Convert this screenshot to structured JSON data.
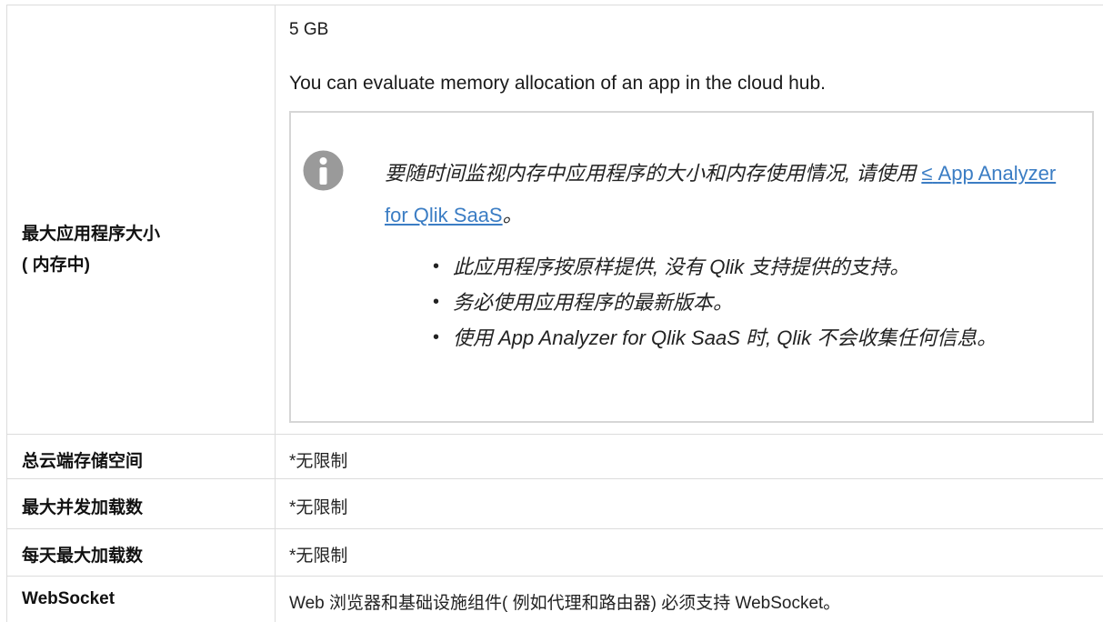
{
  "rows": [
    {
      "label_line1": "最大应用程序大小",
      "label_line2": "( 内存中)",
      "value": "5 GB",
      "description": "You can evaluate memory allocation of an app in the cloud hub.",
      "note": {
        "icon": "info-icon",
        "text_before_link": "要随时间监视内存中应用程序的大小和内存使用情况, 请使用 ",
        "link_symbol": "≤",
        "link_text": "App Analyzer for Qlik SaaS",
        "text_after_link": "。",
        "bullets": [
          "此应用程序按原样提供, 没有 Qlik 支持提供的支持。",
          "务必使用应用程序的最新版本。",
          "使用 App Analyzer for Qlik SaaS 时, Qlik 不会收集任何信息。"
        ]
      }
    },
    {
      "label": "总云端存储空间",
      "value": "*无限制"
    },
    {
      "label": "最大并发加载数",
      "value": "*无限制"
    },
    {
      "label": "每天最大加载数",
      "value": "*无限制"
    },
    {
      "label": "WebSocket",
      "value": "Web 浏览器和基础设施组件( 例如代理和路由器) 必须支持 WebSocket。"
    }
  ],
  "colors": {
    "border": "#dcdcdc",
    "link": "#3b7dc4",
    "icon": "#9a9a9a"
  }
}
